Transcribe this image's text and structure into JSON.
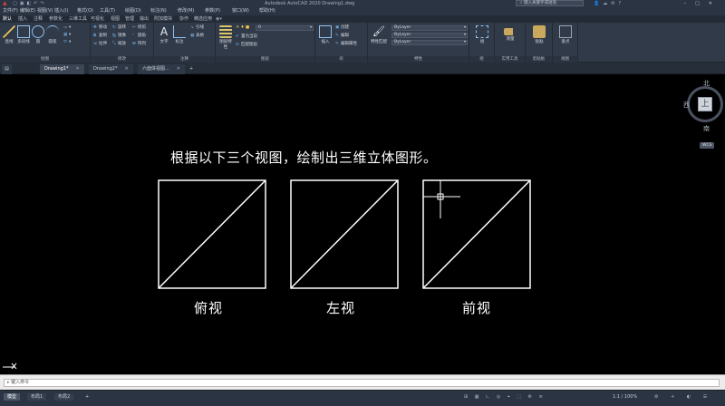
{
  "app": {
    "title": "Autodesk AutoCAD 2020   Drawing1.dwg",
    "help_search_placeholder": "键入关键字或短语"
  },
  "menu": [
    "文件(F)",
    "编辑(E)",
    "视图(V)",
    "插入(I)",
    "格式(O)",
    "工具(T)",
    "绘图(D)",
    "标注(N)",
    "修改(M)",
    "参数(P)",
    "窗口(W)",
    "帮助(H)"
  ],
  "ribbon_tabs": [
    {
      "label": "默认",
      "active": true
    },
    {
      "label": "插入",
      "active": false
    },
    {
      "label": "注释",
      "active": false
    },
    {
      "label": "参数化",
      "active": false
    },
    {
      "label": "三维工具",
      "active": false
    },
    {
      "label": "可视化",
      "active": false
    },
    {
      "label": "视图",
      "active": false
    },
    {
      "label": "管理",
      "active": false
    },
    {
      "label": "输出",
      "active": false
    },
    {
      "label": "附加模块",
      "active": false
    },
    {
      "label": "协作",
      "active": false
    },
    {
      "label": "精选应用",
      "active": false
    }
  ],
  "ribbon_panels": {
    "draw": {
      "label": "绘图",
      "tools": [
        "直线",
        "多段线",
        "圆",
        "圆弧"
      ]
    },
    "modify": {
      "label": "修改",
      "tools": [
        "移动",
        "旋转",
        "修剪",
        "复制",
        "镜像",
        "圆角",
        "拉伸",
        "缩放",
        "阵列"
      ]
    },
    "annotation": {
      "label": "注释",
      "tools": [
        "文字",
        "标注",
        "引线",
        "表格"
      ]
    },
    "layers": {
      "label": "图层",
      "current_layer": "0",
      "tools": [
        "图层特性",
        "置为当前",
        "匹配图层"
      ]
    },
    "block": {
      "label": "块",
      "tools": [
        "插入",
        "创建",
        "编辑",
        "编辑属性"
      ]
    },
    "properties": {
      "label": "特性",
      "color": "ByLayer",
      "linetype": "ByLayer",
      "lineweight": "ByLayer",
      "tools": [
        "特性匹配"
      ]
    },
    "groups": {
      "label": "组",
      "tools": [
        "组"
      ]
    },
    "utilities": {
      "label": "实用工具",
      "tools": [
        "测量"
      ]
    },
    "clipboard": {
      "label": "剪贴板",
      "tools": [
        "粘贴"
      ]
    },
    "view": {
      "label": "视图",
      "tools": [
        "基点"
      ]
    }
  },
  "doc_tabs": [
    {
      "label": "开始",
      "active": false
    },
    {
      "label": "Drawing1*",
      "active": true
    },
    {
      "label": "Drawing2*",
      "active": false
    },
    {
      "label": "六面体视图...",
      "active": false
    }
  ],
  "canvas": {
    "instruction": "根据以下三个视图，绘制出三维立体图形。",
    "views": [
      {
        "label": "俯视"
      },
      {
        "label": "左视"
      },
      {
        "label": "前视"
      }
    ]
  },
  "viewcube": {
    "top": "上",
    "north": "北",
    "south": "南",
    "west": "西",
    "wcs": "WCS"
  },
  "command_line": {
    "placeholder": "键入命令"
  },
  "layout_tabs": [
    {
      "label": "模型",
      "active": true
    },
    {
      "label": "布局1",
      "active": false
    },
    {
      "label": "布局2",
      "active": false
    },
    {
      "label": "+",
      "active": false
    }
  ],
  "status": {
    "model_label": "模型",
    "zoom": "1:1 / 100%"
  }
}
